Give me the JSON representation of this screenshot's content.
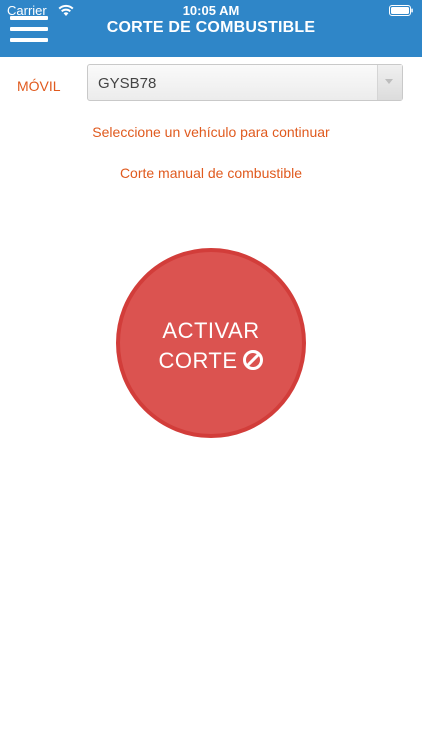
{
  "status_bar": {
    "carrier": "Carrier",
    "time": "10:05 AM",
    "icons": [
      "wifi-icon",
      "battery-icon"
    ]
  },
  "header": {
    "title": "CORTE DE COMBUSTIBLE",
    "menu_icon": "hamburger-menu-icon",
    "background_color": "#2f86c8"
  },
  "vehicle_selector": {
    "label": "MÓVIL",
    "selected_value": "GYSB78",
    "arrow_icon": "chevron-down-icon"
  },
  "messages": {
    "hint": "Seleccione un vehículo para continuar",
    "manual_link": "Corte manual de combustible"
  },
  "activate_button": {
    "line1": "ACTIVAR",
    "line2": "CORTE",
    "icon": "ban-icon",
    "color": "#db5350"
  },
  "accent_color": "#e05a1e"
}
